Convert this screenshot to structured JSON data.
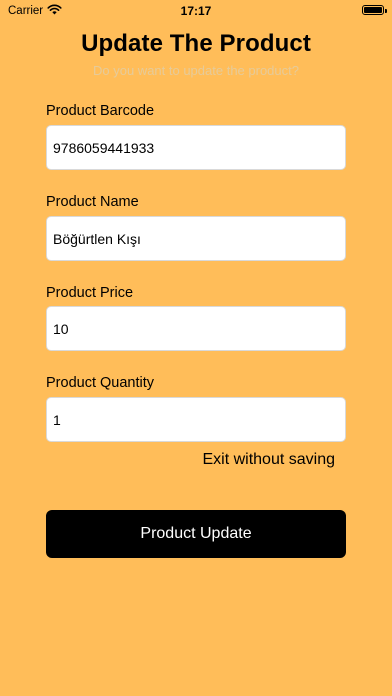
{
  "status_bar": {
    "carrier": "Carrier",
    "time": "17:17",
    "icons": [
      "wifi-icon",
      "battery-icon"
    ]
  },
  "header": {
    "title": "Update The Product",
    "subtitle": "Do you want to update the product?"
  },
  "form": {
    "barcode": {
      "label": "Product Barcode",
      "value": "9786059441933"
    },
    "name": {
      "label": "Product Name",
      "value": "Böğürtlen Kışı"
    },
    "price": {
      "label": "Product Price",
      "value": "10"
    },
    "quantity": {
      "label": "Product Quantity",
      "value": "1"
    }
  },
  "actions": {
    "exit_label": "Exit without saving",
    "update_label": "Product Update"
  },
  "colors": {
    "background": "#FFBD59",
    "button": "#000000",
    "button_text": "#FFFFFF",
    "subtitle": "#E6CB9A"
  }
}
